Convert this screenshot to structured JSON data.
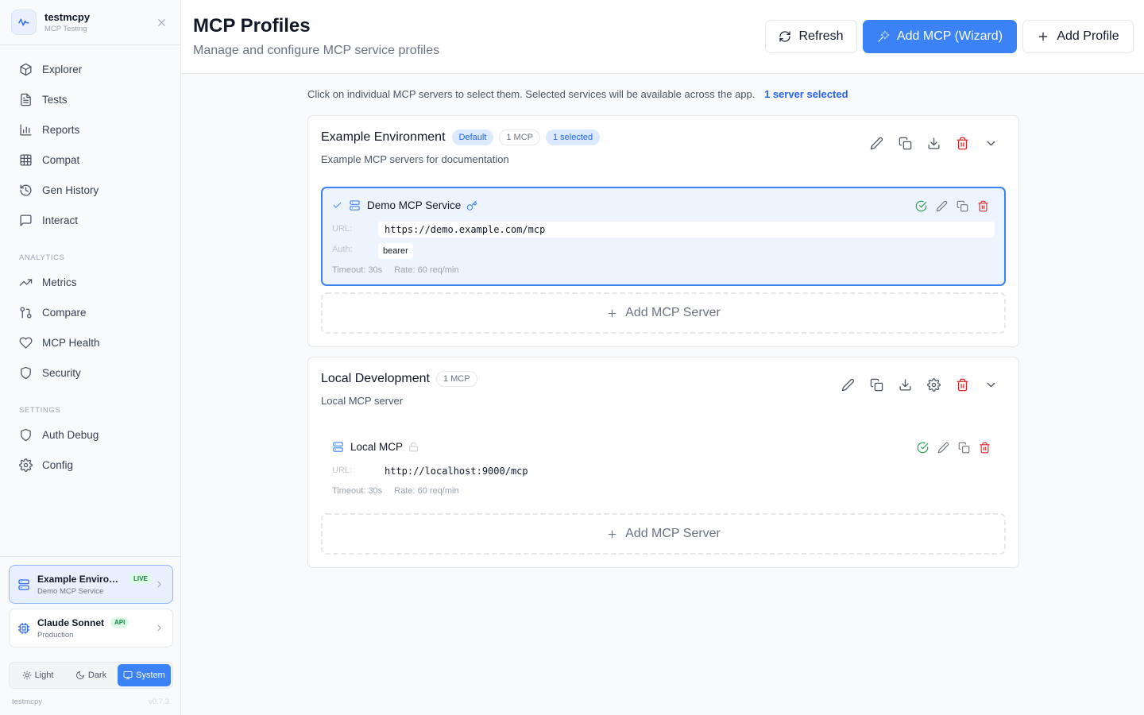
{
  "sidebar": {
    "brand_name": "testmcpy",
    "brand_sub": "MCP Testing",
    "nav": [
      {
        "label": "Explorer",
        "icon": "cube-icon"
      },
      {
        "label": "Tests",
        "icon": "file-text-icon"
      },
      {
        "label": "Reports",
        "icon": "bar-chart-icon"
      },
      {
        "label": "Compat",
        "icon": "grid-icon"
      },
      {
        "label": "Gen History",
        "icon": "history-icon"
      },
      {
        "label": "Interact",
        "icon": "message-icon"
      }
    ],
    "analytics_label": "ANALYTICS",
    "analytics": [
      {
        "label": "Metrics",
        "icon": "trending-up-icon"
      },
      {
        "label": "Compare",
        "icon": "compare-icon"
      },
      {
        "label": "MCP Health",
        "icon": "heart-icon"
      },
      {
        "label": "Security",
        "icon": "shield-icon"
      }
    ],
    "settings_label": "SETTINGS",
    "settings": [
      {
        "label": "Auth Debug",
        "icon": "shield-icon"
      },
      {
        "label": "Config",
        "icon": "gear-icon"
      }
    ],
    "context_mcp": {
      "title": "Example Environm...",
      "badge": "LIVE",
      "sub": "Demo MCP Service"
    },
    "context_llm": {
      "title": "Claude Sonnet",
      "badge": "API",
      "sub": "Production"
    },
    "theme": {
      "light": "Light",
      "dark": "Dark",
      "system": "System",
      "selected": "System"
    },
    "footer_name": "testmcpy",
    "footer_version": "v0.7.3"
  },
  "header": {
    "title": "MCP Profiles",
    "subtitle": "Manage and configure MCP service profiles",
    "refresh_label": "Refresh",
    "wizard_label": "Add MCP (Wizard)",
    "add_profile_label": "Add Profile"
  },
  "info": {
    "text": "Click on individual MCP servers to select them. Selected services will be available across the app.",
    "selected": "1 server selected"
  },
  "profiles": [
    {
      "name": "Example Environment",
      "badge_default": "Default",
      "badge_count": "1 MCP",
      "badge_selected": "1 selected",
      "description": "Example MCP servers for documentation",
      "server": {
        "name": "Demo MCP Service",
        "url_label": "URL:",
        "url": "https://demo.example.com/mcp",
        "auth_label": "Auth:",
        "auth": "bearer",
        "timeout": "Timeout: 30s",
        "rate": "Rate: 60 req/min",
        "selected": true
      },
      "add_server_label": "Add MCP Server"
    },
    {
      "name": "Local Development",
      "badge_count": "1 MCP",
      "description": "Local MCP server",
      "server": {
        "name": "Local MCP",
        "url_label": "URL:",
        "url": "http://localhost:9000/mcp",
        "timeout": "Timeout: 30s",
        "rate": "Rate: 60 req/min",
        "selected": false
      },
      "add_server_label": "Add MCP Server"
    }
  ],
  "colors": {
    "accent": "#3b82f6",
    "danger": "#dc2626",
    "success": "#16a34a"
  }
}
